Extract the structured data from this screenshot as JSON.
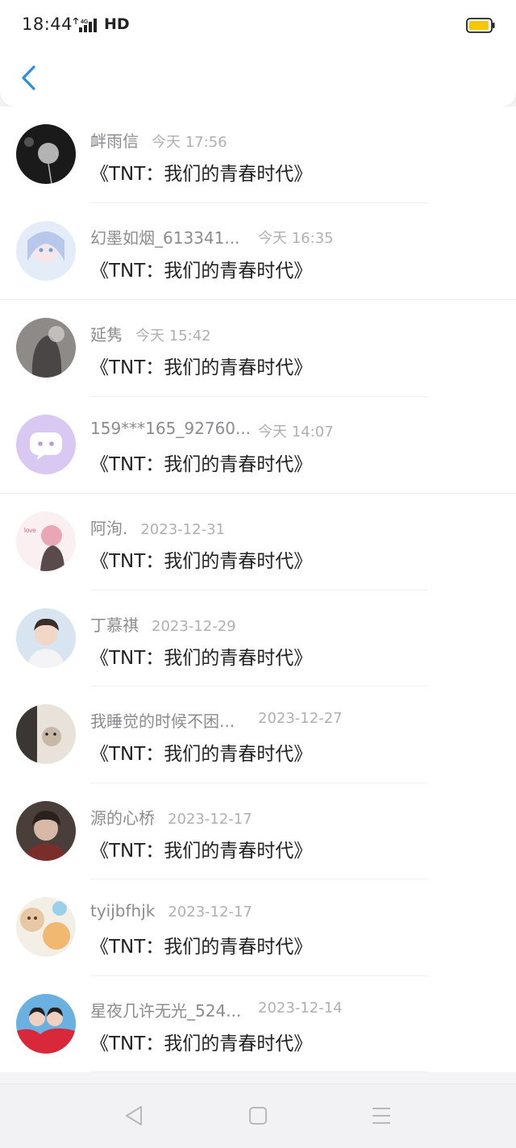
{
  "status_bar": {
    "time": "18:44",
    "network": "4G",
    "hd": "HD"
  },
  "header": {
    "back_icon": "chevron-left-icon"
  },
  "items": [
    {
      "name": "衅雨信",
      "date": "今天 17:56",
      "title": "《TNT：我们的青春时代》"
    },
    {
      "name": "幻墨如烟_613341...",
      "date": "今天 16:35",
      "title": "《TNT：我们的青春时代》"
    },
    {
      "name": "延隽",
      "date": "今天 15:42",
      "title": "《TNT：我们的青春时代》"
    },
    {
      "name": "159***165_92760...",
      "date": "今天 14:07",
      "title": "《TNT：我们的青春时代》"
    },
    {
      "name": "阿洵.",
      "date": "2023-12-31",
      "title": "《TNT：我们的青春时代》"
    },
    {
      "name": "丁慕祺",
      "date": "2023-12-29",
      "title": "《TNT：我们的青春时代》"
    },
    {
      "name": "我睡觉的时候不困...",
      "date": "2023-12-27",
      "title": "《TNT：我们的青春时代》"
    },
    {
      "name": "源的心桥",
      "date": "2023-12-17",
      "title": "《TNT：我们的青春时代》"
    },
    {
      "name": "tyijbfhjk",
      "date": "2023-12-17",
      "title": "《TNT：我们的青春时代》"
    },
    {
      "name": "星夜几许无光_524...",
      "date": "2023-12-14",
      "title": "《TNT：我们的青春时代》"
    }
  ],
  "nav_bar": {
    "back_icon": "triangle-back-icon",
    "home_icon": "square-home-icon",
    "menu_icon": "hamburger-menu-icon"
  },
  "colors": {
    "accent": "#2b8fe0",
    "battery": "#f5c800"
  }
}
